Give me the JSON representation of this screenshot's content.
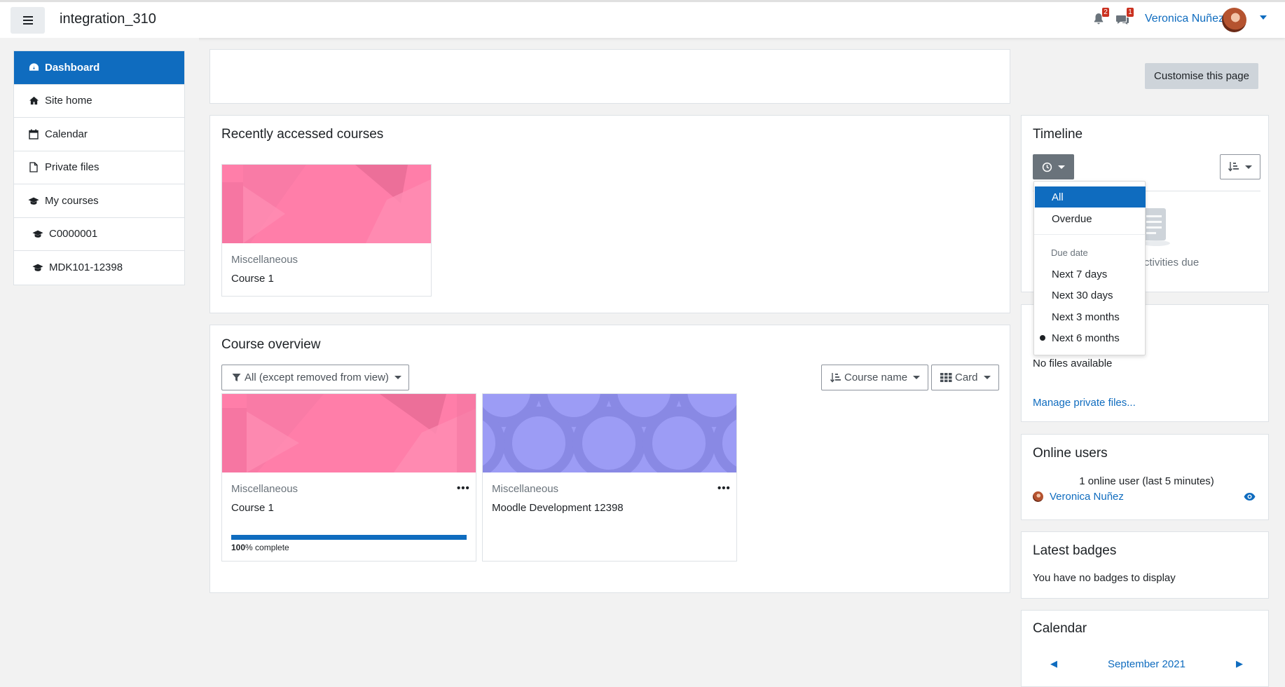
{
  "header": {
    "site_name": "integration_310",
    "notifications_count": "2",
    "messages_count": "1",
    "user_name": "Veronica Nuñez"
  },
  "nav": {
    "items": [
      {
        "label": "Dashboard",
        "icon": "dashboard-icon",
        "active": true
      },
      {
        "label": "Site home",
        "icon": "home-icon"
      },
      {
        "label": "Calendar",
        "icon": "calendar-icon"
      },
      {
        "label": "Private files",
        "icon": "file-icon"
      },
      {
        "label": "My courses",
        "icon": "graduation-cap-icon"
      },
      {
        "label": "C0000001",
        "icon": "graduation-cap-icon"
      },
      {
        "label": "MDK101-12398",
        "icon": "graduation-cap-icon"
      }
    ]
  },
  "page": {
    "customise_label": "Customise this page"
  },
  "recent": {
    "title": "Recently accessed courses",
    "courses": [
      {
        "category": "Miscellaneous",
        "name": "Course 1"
      }
    ]
  },
  "overview": {
    "title": "Course overview",
    "filter_label": "All (except removed from view)",
    "sort_label": "Course name",
    "view_label": "Card",
    "courses": [
      {
        "category": "Miscellaneous",
        "name": "Course 1",
        "progress_percent": "100",
        "progress_suffix": "% complete",
        "progress_value": 100
      },
      {
        "category": "Miscellaneous",
        "name": "Moodle Development 12398"
      }
    ]
  },
  "timeline": {
    "title": "Timeline",
    "empty_text_partial": "g activities due",
    "menu": {
      "items": [
        {
          "label": "All",
          "selected": true
        },
        {
          "label": "Overdue"
        }
      ],
      "header": "Due date",
      "date_items": [
        {
          "label": "Next 7 days"
        },
        {
          "label": "Next 30 days"
        },
        {
          "label": "Next 3 months"
        },
        {
          "label": "Next 6 months",
          "checked": true
        }
      ]
    }
  },
  "private_files": {
    "empty_text": "No files available",
    "manage_link": "Manage private files..."
  },
  "online_users": {
    "title": "Online users",
    "summary": "1 online user (last 5 minutes)",
    "users": [
      {
        "name": "Veronica Nuñez"
      }
    ]
  },
  "badges": {
    "title": "Latest badges",
    "empty_text": "You have no badges to display"
  },
  "calendar": {
    "title": "Calendar",
    "month": "September 2021"
  },
  "colors": {
    "primary": "#0f6cbf",
    "badge_red": "#ca3120"
  }
}
